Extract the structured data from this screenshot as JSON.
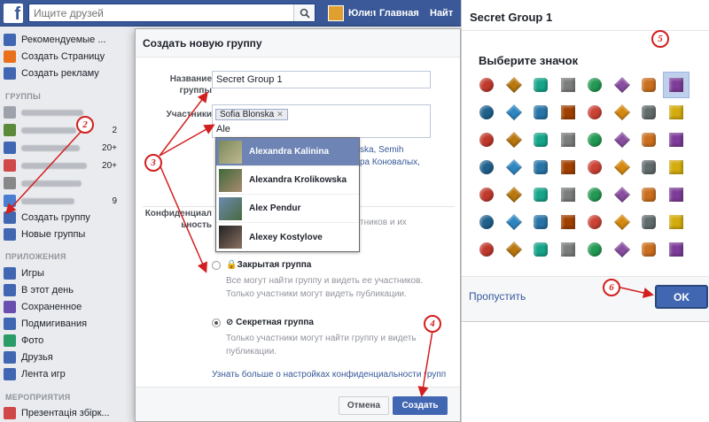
{
  "topbar": {
    "search_placeholder": "Ищите друзей",
    "user_name": "Юлия",
    "home_label": "Главная",
    "find_label": "Найт"
  },
  "sidebar": {
    "top_items": [
      {
        "label": "Рекомендуемые ..."
      },
      {
        "label": "Создать Страницу"
      },
      {
        "label": "Создать рекламу"
      }
    ],
    "groups_header": "ГРУППЫ",
    "group_counts": [
      "2",
      "20+",
      "20+",
      "9"
    ],
    "create_group": "Создать группу",
    "new_groups": "Новые группы",
    "apps_header": "ПРИЛОЖЕНИЯ",
    "apps": [
      {
        "label": "Игры"
      },
      {
        "label": "В этот день"
      },
      {
        "label": "Сохраненное"
      },
      {
        "label": "Подмигивания"
      },
      {
        "label": "Фото"
      },
      {
        "label": "Друзья"
      },
      {
        "label": "Лента игр"
      }
    ],
    "events_header": "МЕРОПРИЯТИЯ",
    "events": [
      {
        "label": "Презентація збірк..."
      }
    ]
  },
  "modal": {
    "title": "Создать новую группу",
    "name_label": "Название группы",
    "name_value": "Secret Group 1",
    "members_label": "Участники",
    "member_token": "Sofia Blonska",
    "member_typed": "Ale",
    "suggest_peek_line1": "ska, Semih",
    "suggest_peek_line2": "ра Коновалых,",
    "suggestions": [
      {
        "name": "Alexandra Kalinina"
      },
      {
        "name": "Alexandra Krolikowska"
      },
      {
        "name": "Alex Pendur"
      },
      {
        "name": "Alexey Kostylove"
      }
    ],
    "privacy_label": "Конфиденциальность",
    "open_desc_peek_line1": "тников и их",
    "closed_title": "Закрытая группа",
    "closed_desc": "Все могут найти группу и видеть ее участников. Только участники могут видеть публикации.",
    "secret_title": "Секретная группа",
    "secret_desc": "Только участники могут найти группу и видеть публикации.",
    "learn_more": "Узнать больше о настройках конфиденциальности групп",
    "cancel_label": "Отмена",
    "create_label": "Создать"
  },
  "icon_picker": {
    "title": "Secret Group 1",
    "heading": "Выберите значок",
    "selected_index": 7,
    "icons": [
      "hockey-puck-icon",
      "house-icon",
      "mug-icon",
      "gavel-icon",
      "pie-chart-icon",
      "guitar-icon",
      "calculator-icon",
      "bookshelf-icon",
      "planet-icon",
      "book-icon",
      "frame-icon",
      "map-pin-icon",
      "star-icon",
      "gold-coin-icon",
      "basketball-icon",
      "bone-icon",
      "film-icon",
      "baseball-icon",
      "tennis-ball-icon",
      "hand-rock-icon",
      "chip-icon",
      "palette-icon",
      "megaphone-icon",
      "heart-icon",
      "flask-icon",
      "globe-icon",
      "gamepad-icon",
      "rook-icon",
      "cup-icon",
      "fist-icon",
      "fishbowl-icon",
      "graduation-cap-icon",
      "masks-icon",
      "trophy-icon",
      "football-icon",
      "sunflower-icon",
      "soccer-ball-icon",
      "skull-icon",
      "bird-icon",
      "mountains-icon",
      "thumbs-up-icon",
      "barn-icon",
      "camera-icon",
      "horse-icon",
      "teddy-bear-icon",
      "tree-icon",
      "paw-icon",
      "ambulance-icon",
      "flag-icon",
      "dice-icon",
      "people-icon",
      "glasses-icon",
      "wine-glass-icon",
      "music-notes-icon",
      "shield-icon",
      "gift-icon"
    ],
    "skip_label": "Пропустить",
    "ok_label": "OK"
  },
  "annotations": [
    "2",
    "3",
    "4",
    "5",
    "6"
  ]
}
